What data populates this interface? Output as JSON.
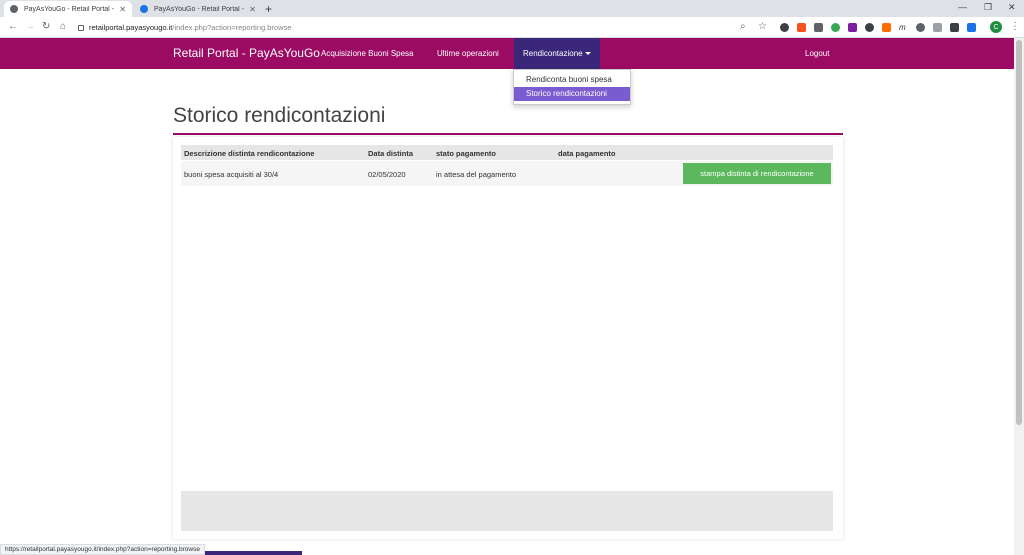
{
  "browser": {
    "tabs": [
      {
        "title": "PayAsYouGo - Retail Portal - Pay",
        "active": true,
        "favicon_color": "#5f6368"
      },
      {
        "title": "PayAsYouGo - Retail Portal - Pay",
        "active": false,
        "favicon_color": "#1a73e8"
      }
    ],
    "url_domain": "retailportal.payasyougo.it",
    "url_path": "/index.php?action=reporting.browse",
    "profile_initial": "C",
    "status_url": "https://retailportal.payasyougo.it/index.php?action=reporting.browse"
  },
  "navbar": {
    "brand": "Retail Portal - PayAsYouGo",
    "links": [
      "Acquisizione Buoni Spesa",
      "Ultime operazioni"
    ],
    "dropdown_label": "Rendicontazione",
    "logout": "Logout",
    "dropdown_items": [
      "Rendiconta buoni spesa",
      "Storico rendicontazioni"
    ],
    "colors": {
      "brand_bar": "#9b0b63",
      "active_dropdown": "#3b2779",
      "selected_item": "#7b5bd0"
    }
  },
  "page": {
    "title": "Storico rendicontazioni"
  },
  "table": {
    "headers": [
      "Descrizione distinta rendicontazione",
      "Data distinta",
      "stato pagamento",
      "data pagamento"
    ],
    "rows": [
      {
        "descrizione": "buoni spesa acquisiti al 30/4",
        "data_distinta": "02/05/2020",
        "stato": "in attesa del pagamento",
        "data_pagamento": "",
        "action": "stampa distinta di rendicontazione"
      }
    ],
    "action_color": "#5cb85c"
  }
}
